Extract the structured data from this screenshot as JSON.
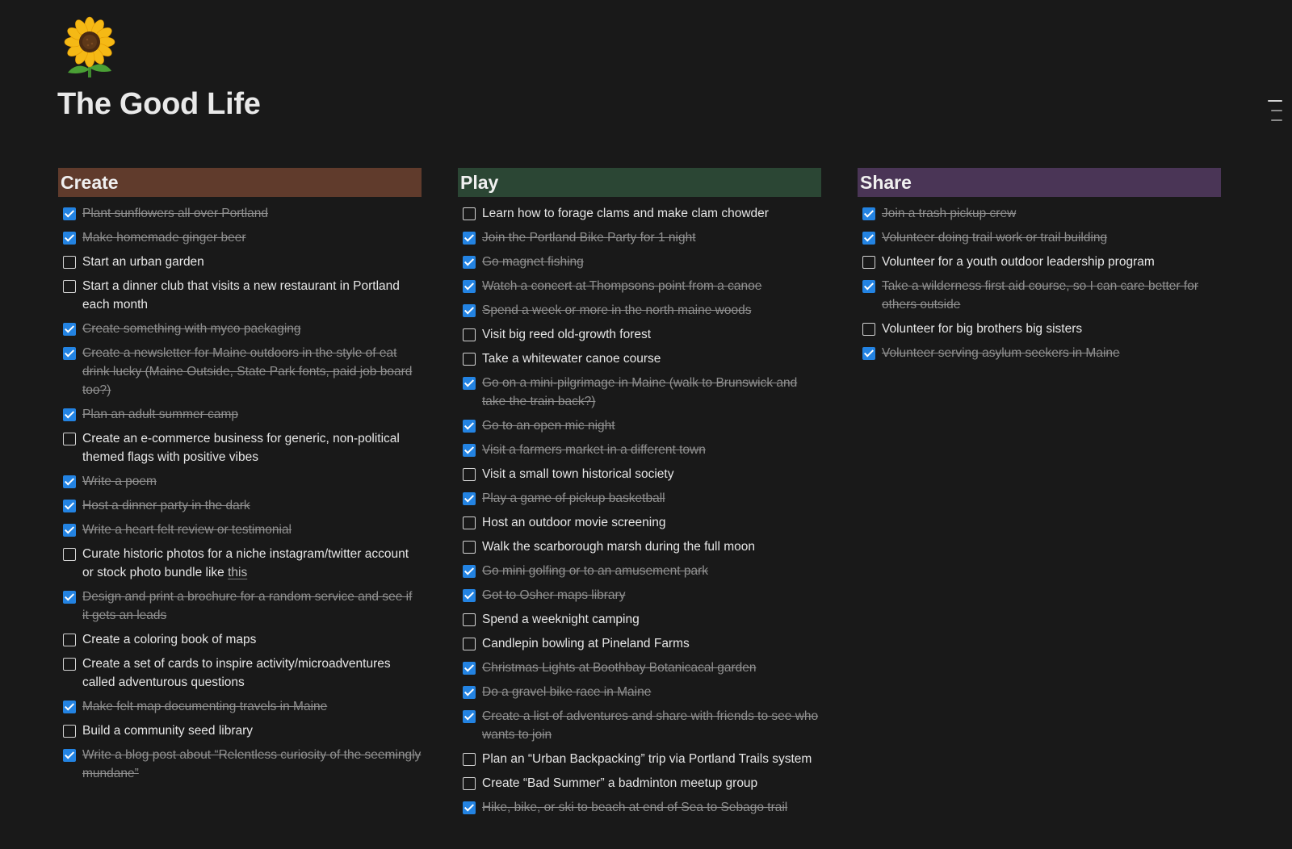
{
  "page": {
    "title": "The Good Life",
    "icon": "sunflower-icon"
  },
  "colors": {
    "background": "#191919",
    "checkbox_checked": "#2383e2",
    "create_header": "#603b2c",
    "play_header": "#2b4634",
    "share_header": "#4a3556"
  },
  "columns": [
    {
      "title": "Create",
      "items": [
        {
          "text": "Plant sunflowers all over Portland",
          "checked": true
        },
        {
          "text": "Make homemade ginger beer",
          "checked": true
        },
        {
          "text": "Start an urban garden",
          "checked": false
        },
        {
          "text": "Start a dinner club that visits a new restaurant in Portland each month",
          "checked": false
        },
        {
          "text": "Create something with myco packaging",
          "checked": true
        },
        {
          "text": "Create a newsletter for Maine outdoors in the style of eat drink lucky (Maine Outside, State Park fonts, paid job board too?)",
          "checked": true
        },
        {
          "text": "Plan an adult summer camp",
          "checked": true
        },
        {
          "text": "Create an e-commerce business for generic, non-political themed flags with positive vibes",
          "checked": false
        },
        {
          "text": "Write a poem",
          "checked": true
        },
        {
          "text": "Host a dinner party in the dark",
          "checked": true
        },
        {
          "text": "Write a heart felt review or testimonial",
          "checked": true
        },
        {
          "text": "Curate historic photos for a niche instagram/twitter account or stock photo bundle like",
          "link": "this",
          "checked": false
        },
        {
          "text": "Design and print a brochure for a random service and see if it gets an leads",
          "checked": true
        },
        {
          "text": "Create a coloring book of maps",
          "checked": false
        },
        {
          "text": "Create a set of cards to inspire activity/microadventures called adventurous questions",
          "checked": false
        },
        {
          "text": "Make felt map documenting travels in Maine",
          "checked": true
        },
        {
          "text": "Build a community seed library",
          "checked": false
        },
        {
          "text": "Write a blog post about “Relentless curiosity of the seemingly mundane”",
          "checked": true
        }
      ]
    },
    {
      "title": "Play",
      "items": [
        {
          "text": "Learn how to forage clams and make clam chowder",
          "checked": false
        },
        {
          "text": "Join the Portland Bike Party for 1 night",
          "checked": true
        },
        {
          "text": "Go magnet fishing",
          "checked": true
        },
        {
          "text": "Watch a concert at Thompsons point from a canoe",
          "checked": true
        },
        {
          "text": "Spend a week or more in the north maine woods",
          "checked": true
        },
        {
          "text": "Visit big reed old-growth forest",
          "checked": false
        },
        {
          "text": "Take a whitewater canoe course",
          "checked": false
        },
        {
          "text": "Go on a mini-pilgrimage in Maine (walk to Brunswick and take the train back?)",
          "checked": true
        },
        {
          "text": "Go to an open mic night",
          "checked": true
        },
        {
          "text": "Visit a farmers market in a different town",
          "checked": true
        },
        {
          "text": "Visit a small town historical society",
          "checked": false
        },
        {
          "text": "Play a game of pickup basketball",
          "checked": true
        },
        {
          "text": "Host an outdoor movie screening",
          "checked": false
        },
        {
          "text": "Walk the scarborough marsh during the full moon",
          "checked": false
        },
        {
          "text": "Go mini golfing or to an amusement park",
          "checked": true
        },
        {
          "text": "Got to Osher maps library",
          "checked": true
        },
        {
          "text": "Spend a weeknight camping",
          "checked": false
        },
        {
          "text": "Candlepin bowling at Pineland Farms",
          "checked": false
        },
        {
          "text": "Christmas Lights at Boothbay Botanicacal garden",
          "checked": true
        },
        {
          "text": "Do a gravel bike race in Maine",
          "checked": true
        },
        {
          "text": "Create a list of adventures and share with friends to see who wants to join",
          "checked": true
        },
        {
          "text": "Plan an “Urban Backpacking” trip via Portland Trails system",
          "checked": false
        },
        {
          "text": "Create “Bad Summer” a badminton meetup group",
          "checked": false
        },
        {
          "text": "Hike, bike, or ski to beach at end of Sea to Sebago trail",
          "checked": true
        }
      ]
    },
    {
      "title": "Share",
      "items": [
        {
          "text": "Join a trash pickup crew",
          "checked": true
        },
        {
          "text": "Volunteer doing trail work or trail building",
          "checked": true
        },
        {
          "text": "Volunteer for a youth outdoor leadership program",
          "checked": false
        },
        {
          "text": "Take a wilderness first aid course, so I can care better for others outside",
          "checked": true
        },
        {
          "text": "Volunteer for big brothers big sisters",
          "checked": false
        },
        {
          "text": "Volunteer serving asylum seekers in Maine",
          "checked": true
        }
      ]
    }
  ]
}
